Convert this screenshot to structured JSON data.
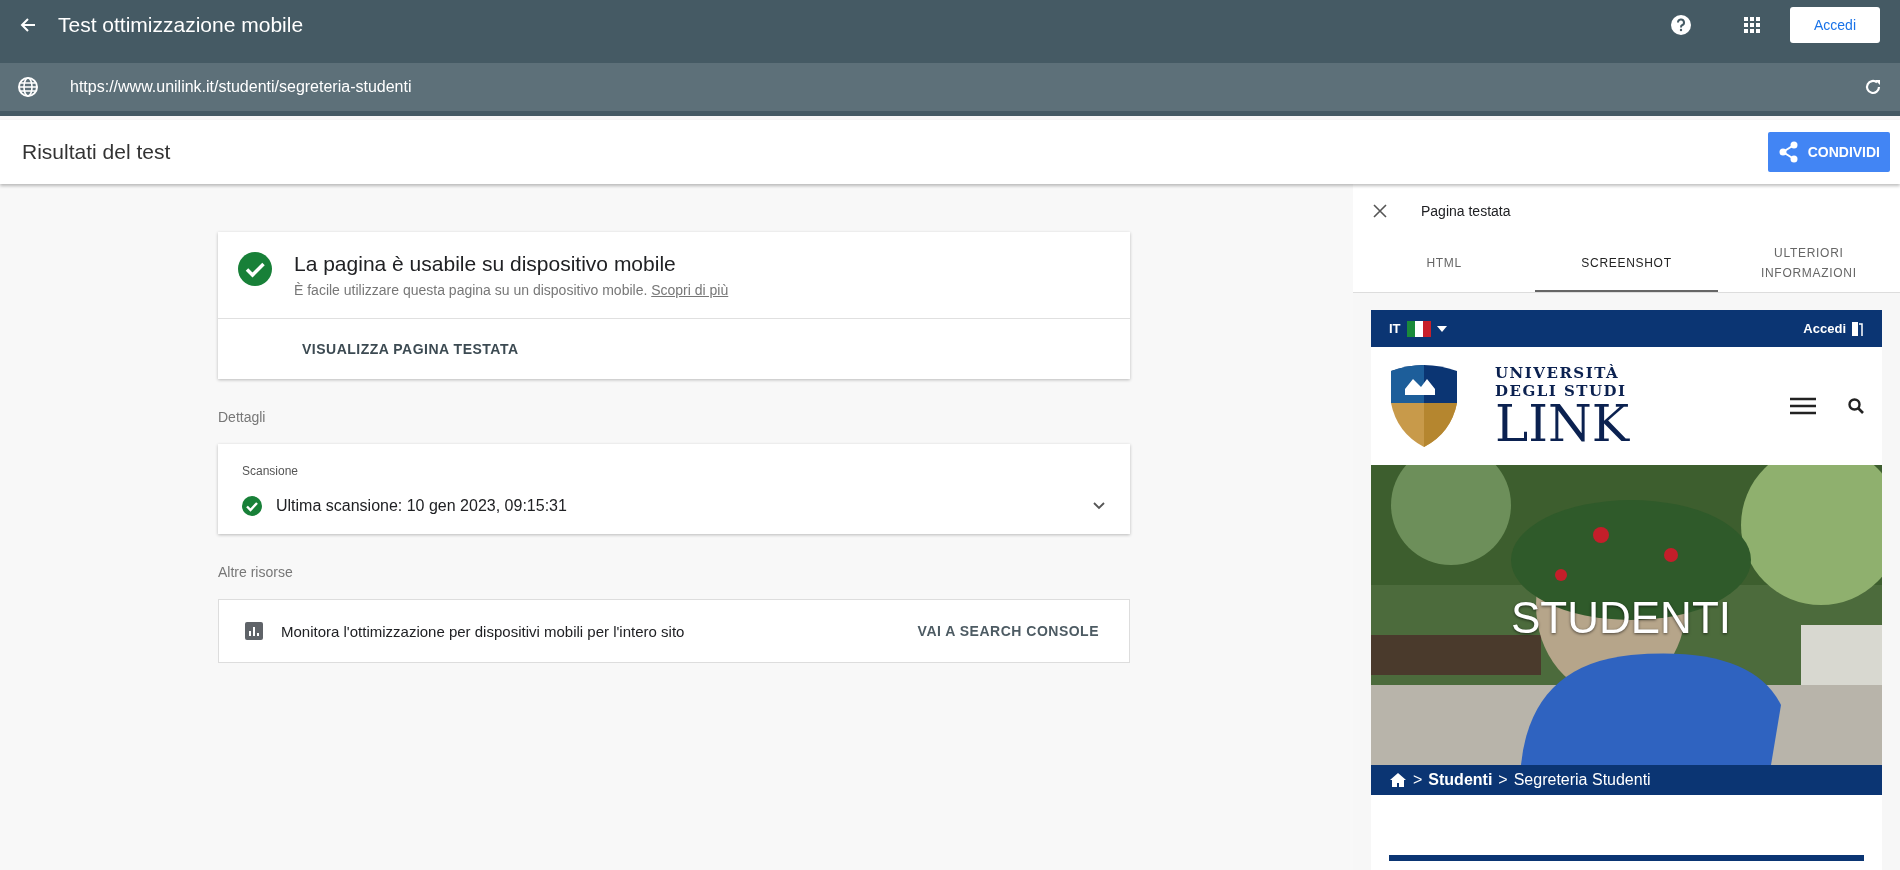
{
  "app_bar": {
    "title": "Test ottimizzazione mobile",
    "sign_in": "Accedi"
  },
  "url_bar": {
    "url": "https://www.unilink.it/studenti/segreteria-studenti"
  },
  "header": {
    "title": "Risultati del test",
    "share": "CONDIVIDI"
  },
  "result_card": {
    "title": "La pagina è usabile su dispositivo mobile",
    "description": "È facile utilizzare questa pagina su un dispositivo mobile.",
    "link": "Scopri di più",
    "action": "VISUALIZZA PAGINA TESTATA"
  },
  "details": {
    "heading": "Dettagli",
    "card_title": "Scansione",
    "crawl": "Ultima scansione: 10 gen 2023, 09:15:31",
    "expanded": false
  },
  "resources": {
    "heading": "Altre risorse",
    "text": "Monitora l'ottimizzazione per dispositivi mobili per l'intero sito",
    "action": "VAI A SEARCH CONSOLE"
  },
  "panel": {
    "title": "Pagina testata",
    "tabs": [
      {
        "label": "HTML",
        "selected": false
      },
      {
        "label": "SCREENSHOT",
        "selected": true
      },
      {
        "label": "ULTERIORI INFORMAZIONI",
        "selected": false
      }
    ],
    "preview": {
      "language": "IT",
      "sign_in": "Accedi",
      "logo_line_1": "UNIVERSITÀ",
      "logo_line_2": "DEGLI STUDI",
      "logo_line_3": "LINK",
      "hero_title": "STUDENTI",
      "breadcrumb_current": "Studenti",
      "breadcrumb_page": "Segreteria Studenti",
      "breadcrumb_sep": ">"
    }
  }
}
